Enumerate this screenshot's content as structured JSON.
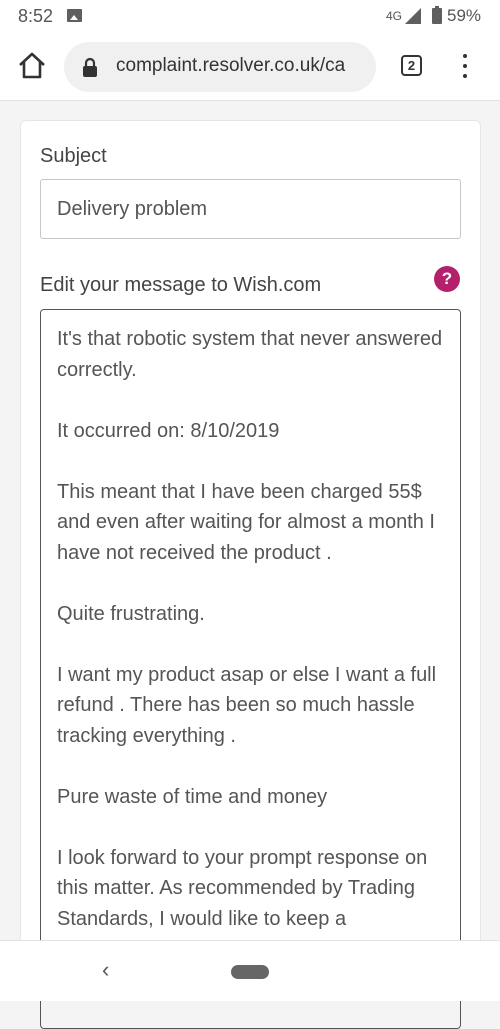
{
  "status_bar": {
    "time": "8:52",
    "network": "4G",
    "battery": "59%"
  },
  "browser": {
    "url": "complaint.resolver.co.uk/ca",
    "tab_count": "2"
  },
  "form": {
    "subject_label": "Subject",
    "subject_value": "Delivery problem",
    "message_label": "Edit your message to Wish.com",
    "help_icon_glyph": "?",
    "message_paragraphs": [
      "It's that robotic system that never answered correctly.",
      "It occurred on:  8/10/2019",
      "This meant that I have been charged 55$ and even after waiting for almost a month I have not received the product .",
      "Quite frustrating.",
      "I want my product asap or else I want a full refund . There has been so much hassle tracking everything .",
      "Pure waste of time and money",
      "I look forward to your prompt response on this matter. As recommended by Trading Standards, I would like to keep a"
    ]
  },
  "nav": {
    "back_glyph": "‹"
  },
  "colors": {
    "help_accent": "#b5206c"
  },
  "icons": [
    "image-notification-icon",
    "signal-icon",
    "battery-icon",
    "home-icon",
    "lock-icon",
    "tabs-icon",
    "more-vert-icon",
    "help-icon",
    "back-icon",
    "home-pill-icon"
  ]
}
